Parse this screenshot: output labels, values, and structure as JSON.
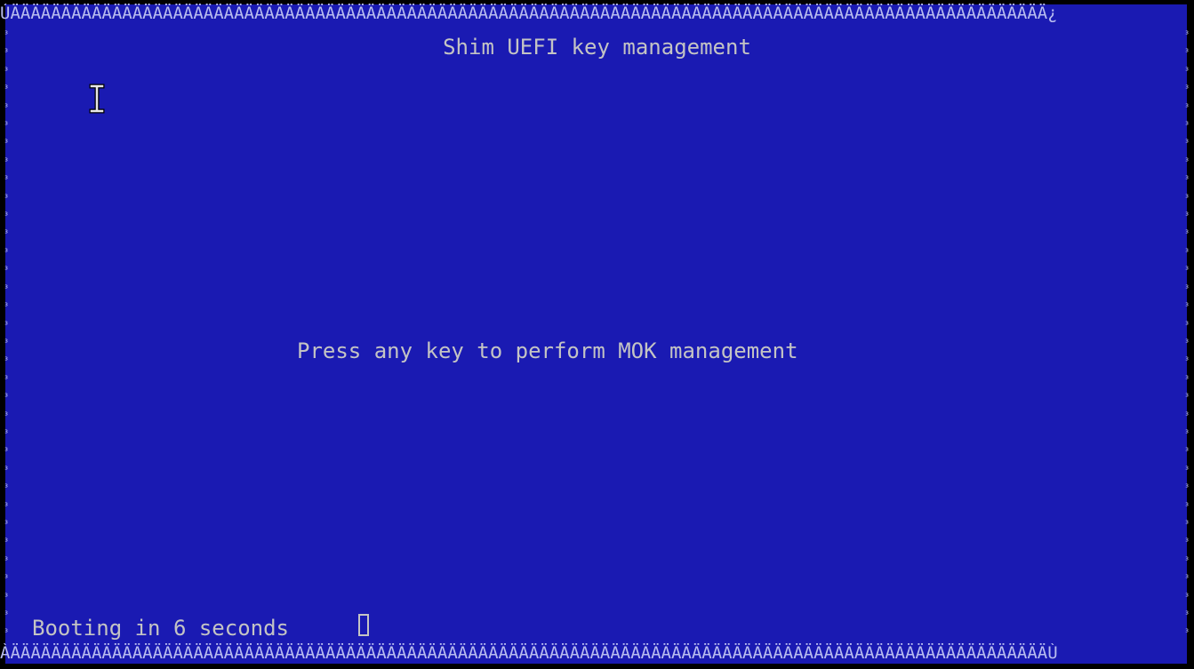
{
  "screen": {
    "title": "Shim UEFI key management",
    "prompt": "Press any key to perform MOK management",
    "countdown": "Booting in 6 seconds"
  },
  "border": {
    "top_row": "ÚÄÄÄÄÄÄÄÄÄÄÄÄÄÄÄÄÄÄÄÄÄÄÄÄÄÄÄÄÄÄÄÄÄÄÄÄÄÄÄÄÄÄÄÄÄÄÄÄÄÄÄÄÄÄÄÄÄÄÄÄÄÄÄÄÄÄÄÄÄÄÄÄÄÄÄÄÄÄÄÄÄÄÄÄÄÄÄÄÄÄÄÄÄÄÄÄÄÄÄÄÄÄ¿",
    "bottom_row": "ÀÄÄÄÄÄÄÄÄÄÄÄÄÄÄÄÄÄÄÄÄÄÄÄÄÄÄÄÄÄÄÄÄÄÄÄÄÄÄÄÄÄÄÄÄÄÄÄÄÄÄÄÄÄÄÄÄÄÄÄÄÄÄÄÄÄÄÄÄÄÄÄÄÄÄÄÄÄÄÄÄÄÄÄÄÄÄÄÄÄÄÄÄÄÄÄÄÄÄÄÄÄÄÙ",
    "left_col": "³\n³\n³\n³\n³\n³\n³\n³\n³\n³\n³\n³\n³\n³\n³\n³\n³\n³\n³\n³\n³\n³\n³\n³\n³\n³\n³\n³\n³\n³\n³\n³\n³\n³",
    "right_col": "³\n³\n³\n³\n³\n³\n³\n³\n³\n³\n³\n³\n³\n³\n³\n³\n³\n³\n³\n³\n³\n³\n³\n³\n³\n³\n³\n³\n³\n³\n³\n³\n³\n³"
  },
  "icons": {
    "mouse_cursor": "text-cursor-icon",
    "input_cursor": "block-cursor-icon"
  },
  "colors": {
    "background": "#1a1ab2",
    "text": "#c4c4c4",
    "border": "#b9bdf0"
  }
}
